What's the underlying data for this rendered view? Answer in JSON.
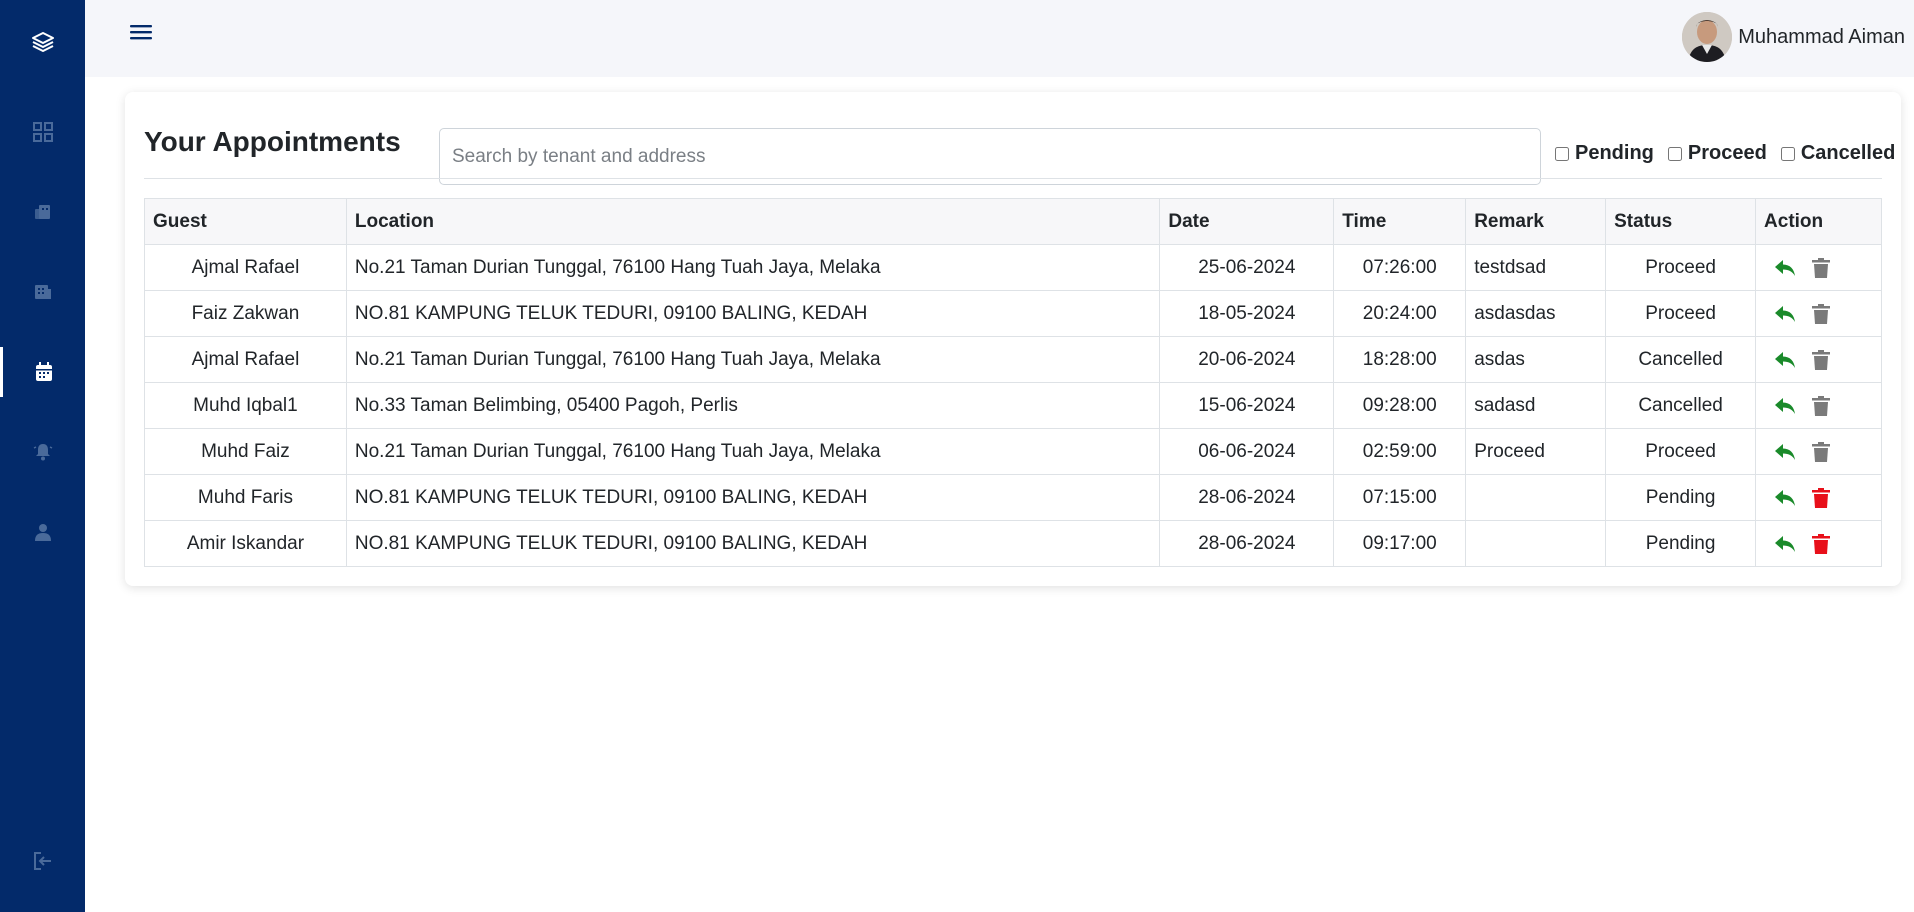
{
  "header": {
    "user_name": "Muhammad Aiman"
  },
  "page": {
    "title": "Your Appointments",
    "search_placeholder": "Search by tenant and address",
    "search_value": "",
    "filters": [
      {
        "label": "Pending",
        "checked": false
      },
      {
        "label": "Proceed",
        "checked": false
      },
      {
        "label": "Cancelled",
        "checked": false
      }
    ]
  },
  "table": {
    "columns": [
      "Guest",
      "Location",
      "Date",
      "Time",
      "Remark",
      "Status",
      "Action"
    ],
    "rows": [
      {
        "guest": "Ajmal Rafael",
        "location": "No.21 Taman Durian Tunggal, 76100 Hang Tuah Jaya, Melaka",
        "date": "25-06-2024",
        "time": "07:26:00",
        "remark": "testdsad",
        "status": "Proceed"
      },
      {
        "guest": "Faiz Zakwan",
        "location": "NO.81 KAMPUNG TELUK TEDURI, 09100 BALING, KEDAH",
        "date": "18-05-2024",
        "time": "20:24:00",
        "remark": "asdasdas",
        "status": "Proceed"
      },
      {
        "guest": "Ajmal Rafael",
        "location": "No.21 Taman Durian Tunggal, 76100 Hang Tuah Jaya, Melaka",
        "date": "20-06-2024",
        "time": "18:28:00",
        "remark": "asdas",
        "status": "Cancelled"
      },
      {
        "guest": "Muhd Iqbal1",
        "location": "No.33 Taman Belimbing, 05400 Pagoh, Perlis",
        "date": "15-06-2024",
        "time": "09:28:00",
        "remark": "sadasd",
        "status": "Cancelled"
      },
      {
        "guest": "Muhd Faiz",
        "location": "No.21 Taman Durian Tunggal, 76100 Hang Tuah Jaya, Melaka",
        "date": "06-06-2024",
        "time": "02:59:00",
        "remark": "Proceed",
        "status": "Proceed"
      },
      {
        "guest": "Muhd Faris",
        "location": "NO.81 KAMPUNG TELUK TEDURI, 09100 BALING, KEDAH",
        "date": "28-06-2024",
        "time": "07:15:00",
        "remark": "",
        "status": "Pending"
      },
      {
        "guest": "Amir Iskandar",
        "location": "NO.81 KAMPUNG TELUK TEDURI, 09100 BALING, KEDAH",
        "date": "28-06-2024",
        "time": "09:17:00",
        "remark": "",
        "status": "Pending"
      }
    ]
  },
  "colors": {
    "sidebar_bg": "#032a6a",
    "sidebar_icon": "#4a6a9a",
    "reply_icon": "#1a8a2a",
    "delete_disabled": "#7a7a7a",
    "delete_active": "#e8101a"
  },
  "icons": {
    "sidebar": [
      "layers-icon",
      "dashboard-grid-icon",
      "property-icon",
      "building-icon",
      "calendar-icon",
      "bell-icon",
      "user-icon",
      "logout-icon"
    ],
    "action": [
      "reply-icon",
      "trash-icon"
    ]
  }
}
